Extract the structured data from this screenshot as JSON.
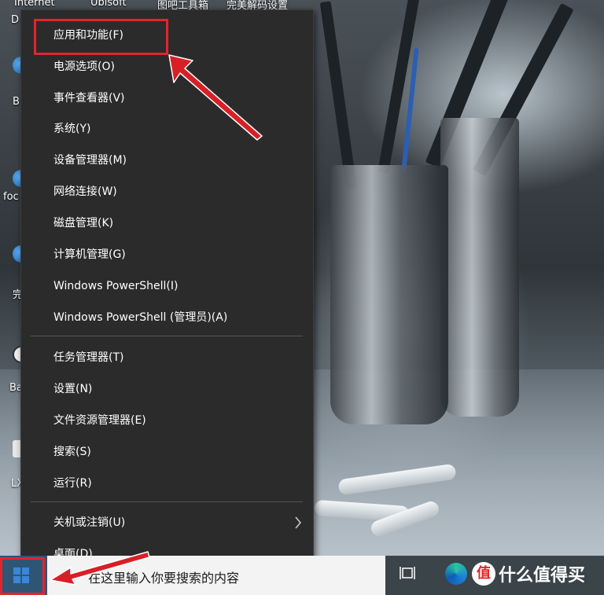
{
  "desktop": {
    "top_labels": [
      "Internet",
      "Ubisoft",
      "图吧工具箱",
      "完美解码设置"
    ],
    "left_labels": [
      "D",
      "B",
      "foc",
      "完",
      "Ba",
      "LX"
    ]
  },
  "context_menu": {
    "group1": [
      {
        "label": "应用和功能(F)"
      },
      {
        "label": "电源选项(O)"
      },
      {
        "label": "事件查看器(V)"
      },
      {
        "label": "系统(Y)"
      },
      {
        "label": "设备管理器(M)"
      },
      {
        "label": "网络连接(W)"
      },
      {
        "label": "磁盘管理(K)"
      },
      {
        "label": "计算机管理(G)"
      },
      {
        "label": "Windows PowerShell(I)"
      },
      {
        "label": "Windows PowerShell (管理员)(A)"
      }
    ],
    "group2": [
      {
        "label": "任务管理器(T)"
      },
      {
        "label": "设置(N)"
      },
      {
        "label": "文件资源管理器(E)"
      },
      {
        "label": "搜索(S)"
      },
      {
        "label": "运行(R)"
      }
    ],
    "group3": [
      {
        "label": "关机或注销(U)",
        "submenu_icon": "chevron-right-icon"
      },
      {
        "label": "桌面(D)"
      }
    ]
  },
  "taskbar": {
    "search_placeholder": "在这里输入你要搜索的内容",
    "brand_badge": "值",
    "brand_text": "什么值得买"
  },
  "annotations": {
    "color": "#e3242b"
  }
}
